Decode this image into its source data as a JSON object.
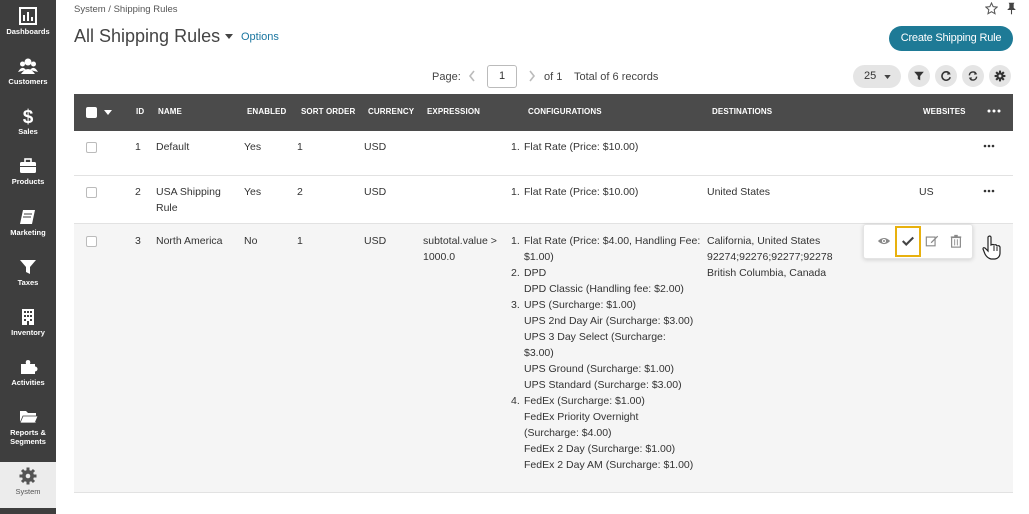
{
  "sidebar": {
    "items": [
      {
        "label": "Dashboards",
        "icon": "dashboards-icon"
      },
      {
        "label": "Customers",
        "icon": "customers-icon"
      },
      {
        "label": "Sales",
        "icon": "dollar-icon"
      },
      {
        "label": "Products",
        "icon": "briefcase-icon"
      },
      {
        "label": "Marketing",
        "icon": "book-icon"
      },
      {
        "label": "Taxes",
        "icon": "funnel-icon"
      },
      {
        "label": "Inventory",
        "icon": "building-icon"
      },
      {
        "label": "Activities",
        "icon": "puzzle-icon"
      },
      {
        "label": "Reports &",
        "label2": "Segments",
        "icon": "folder-icon"
      },
      {
        "label": "System",
        "icon": "gear-icon",
        "active": true
      }
    ]
  },
  "header": {
    "breadcrumb": "System / Shipping Rules",
    "title": "All Shipping Rules",
    "options_label": "Options",
    "create_button": "Create Shipping Rule"
  },
  "pager": {
    "page_label": "Page:",
    "current_page": "1",
    "of_label": "of 1",
    "total_label": "Total of 6 records",
    "per_page": "25"
  },
  "grid": {
    "columns": [
      "ID",
      "NAME",
      "ENABLED",
      "SORT ORDER",
      "CURRENCY",
      "EXPRESSION",
      "CONFIGURATIONS",
      "DESTINATIONS",
      "WEBSITES"
    ],
    "rows": [
      {
        "id": "1",
        "name": "Default",
        "enabled": "Yes",
        "sort_order": "1",
        "currency": "USD",
        "expression": "",
        "configurations": [
          {
            "num": "1.",
            "text": "Flat Rate (Price: $10.00)"
          }
        ],
        "destinations": "",
        "websites": ""
      },
      {
        "id": "2",
        "name": "USA Shipping Rule",
        "enabled": "Yes",
        "sort_order": "2",
        "currency": "USD",
        "expression": "",
        "configurations": [
          {
            "num": "1.",
            "text": "Flat Rate (Price: $10.00)"
          }
        ],
        "destinations": "United States",
        "websites": "US"
      },
      {
        "id": "3",
        "name": "North America",
        "enabled": "No",
        "sort_order": "1",
        "currency": "USD",
        "expression": "subtotal.value > 1000.0",
        "configurations": [
          {
            "num": "1.",
            "text": "Flat Rate (Price: $4.00, Handling Fee: $1.00)"
          },
          {
            "num": "2.",
            "text": "DPD"
          },
          {
            "num": "",
            "text": "DPD Classic (Handling fee: $2.00)"
          },
          {
            "num": "3.",
            "text": "UPS  (Surcharge: $1.00)"
          },
          {
            "num": "",
            "text": "UPS 2nd Day Air (Surcharge: $3.00)"
          },
          {
            "num": "",
            "text": "UPS 3 Day Select (Surcharge: $3.00)"
          },
          {
            "num": "",
            "text": "UPS Ground (Surcharge: $1.00)"
          },
          {
            "num": "",
            "text": "UPS Standard (Surcharge: $3.00)"
          },
          {
            "num": "4.",
            "text": "FedEx  (Surcharge: $1.00)"
          },
          {
            "num": "",
            "text": "FedEx Priority Overnight (Surcharge: $4.00)"
          },
          {
            "num": "",
            "text": "FedEx 2 Day (Surcharge: $1.00)"
          },
          {
            "num": "",
            "text": "FedEx 2 Day AM (Surcharge: $1.00)"
          }
        ],
        "destinations": "California, United States 92274;92276;92277;92278 British Columbia, Canada",
        "websites": ""
      }
    ]
  },
  "row_actions": [
    "view-icon",
    "check-icon",
    "edit-icon",
    "delete-icon"
  ],
  "colors": {
    "sidebar": "#3e3e3e",
    "header": "#4b4b4b",
    "accent": "#1e7a96",
    "highlight": "#e8b10e"
  }
}
